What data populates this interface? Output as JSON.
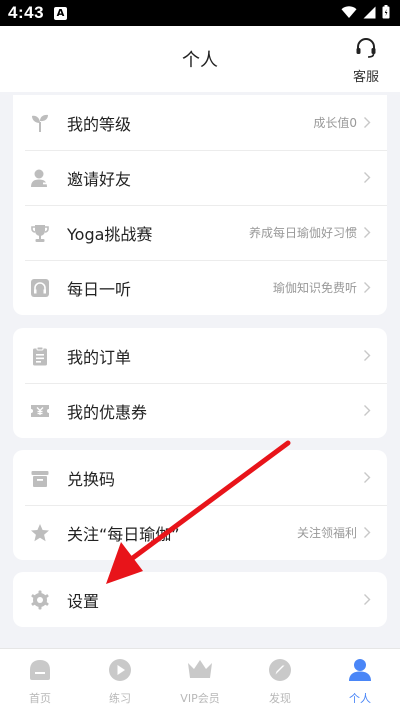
{
  "status_bar": {
    "time": "4:43",
    "badge": "A"
  },
  "header": {
    "title": "个人",
    "service_label": "客服"
  },
  "groups": [
    {
      "items": [
        {
          "icon": "sprout-icon",
          "label": "我的等级",
          "hint": "成长值0"
        },
        {
          "icon": "user-plus-icon",
          "label": "邀请好友",
          "hint": ""
        },
        {
          "icon": "trophy-icon",
          "label": "Yoga挑战赛",
          "hint": "养成每日瑜伽好习惯"
        },
        {
          "icon": "headphones-icon",
          "label": "每日一听",
          "hint": "瑜伽知识免费听"
        }
      ]
    },
    {
      "items": [
        {
          "icon": "clipboard-icon",
          "label": "我的订单",
          "hint": ""
        },
        {
          "icon": "coupon-icon",
          "label": "我的优惠券",
          "hint": ""
        }
      ]
    },
    {
      "items": [
        {
          "icon": "gift-box-icon",
          "label": "兑换码",
          "hint": ""
        },
        {
          "icon": "star-icon",
          "label": "关注“每日瑜伽”",
          "hint": "关注领福利"
        }
      ]
    },
    {
      "items": [
        {
          "icon": "gear-icon",
          "label": "设置",
          "hint": ""
        }
      ]
    }
  ],
  "tabs": [
    {
      "icon": "home-icon",
      "label": "首页",
      "active": false
    },
    {
      "icon": "play-icon",
      "label": "练习",
      "active": false
    },
    {
      "icon": "crown-icon",
      "label": "VIP会员",
      "active": false
    },
    {
      "icon": "compass-icon",
      "label": "发现",
      "active": false
    },
    {
      "icon": "person-icon",
      "label": "个人",
      "active": true
    }
  ],
  "colors": {
    "accent": "#4a86f7",
    "annotation_arrow": "#e8141a",
    "icon_gray": "#b5b5b5"
  }
}
